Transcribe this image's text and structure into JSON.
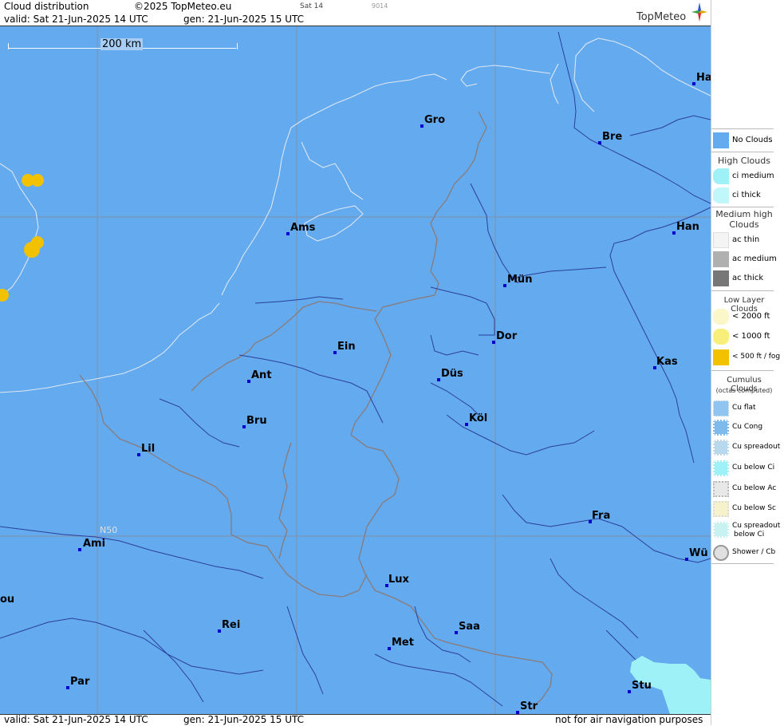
{
  "header": {
    "title": "Cloud distribution",
    "copyright": "©2025 TopMeteo.eu",
    "sat_label": "Sat 14",
    "code": "9014",
    "valid": "valid:  Sat  21-Jun-2025  14 UTC",
    "gen": "gen: 21-Jun-2025 15 UTC",
    "logo": "TopMeteo"
  },
  "map": {
    "scale_label": "200 km",
    "lat_label": "N50",
    "cities": [
      {
        "name": "Ha"
      },
      {
        "name": "Gro"
      },
      {
        "name": "Bre"
      },
      {
        "name": "Ams"
      },
      {
        "name": "Han"
      },
      {
        "name": "Mün"
      },
      {
        "name": "Dor"
      },
      {
        "name": "Ein"
      },
      {
        "name": "Ant"
      },
      {
        "name": "Düs"
      },
      {
        "name": "Kas"
      },
      {
        "name": "Bru"
      },
      {
        "name": "Köl"
      },
      {
        "name": "Lil"
      },
      {
        "name": "Fra"
      },
      {
        "name": "Ami"
      },
      {
        "name": "Wü"
      },
      {
        "name": "Lux"
      },
      {
        "name": "ou"
      },
      {
        "name": "Rei"
      },
      {
        "name": "Saa"
      },
      {
        "name": "Met"
      },
      {
        "name": "Par"
      },
      {
        "name": "Stu"
      },
      {
        "name": "Str"
      }
    ]
  },
  "footer": {
    "valid": "valid:  Sat  21-Jun-2025  14 UTC",
    "gen": "gen: 21-Jun-2025 15 UTC",
    "note": "not for air navigation purposes"
  },
  "legend": {
    "no_clouds": "No Clouds",
    "high_head": "High Clouds",
    "ci_medium": "ci medium",
    "ci_thick": "ci thick",
    "medium_head": "Medium high Clouds",
    "ac_thin": "ac thin",
    "ac_medium": "ac medium",
    "ac_thick": "ac thick",
    "low_head": "Low Layer Clouds",
    "low_2000": "< 2000 ft",
    "low_1000": "< 1000 ft",
    "low_500": "< 500 ft / fog",
    "cu_head": "Cumulus Clouds",
    "cu_sub": "(octas computed)",
    "cu_flat": "Cu flat",
    "cu_cong": "Cu Cong",
    "cu_spread": "Cu spreadout",
    "cu_below_ci": "Cu below Ci",
    "cu_below_ac": "Cu below Ac",
    "cu_below_sc": "Cu below Sc",
    "cu_spread_ci_1": "Cu spreadout",
    "cu_spread_ci_2": "below Ci",
    "shower": "Shower / Cb",
    "colors": {
      "no_clouds": "#63abee",
      "ci_medium": "#9ef2f7",
      "ci_thick": "#c0f7fb",
      "ac_thin": "#f4f4f4",
      "ac_medium": "#b0b0b0",
      "ac_thick": "#777777",
      "low_2000": "#fbf7c8",
      "low_1000": "#f7ef7a",
      "low_500": "#f2c200"
    }
  }
}
